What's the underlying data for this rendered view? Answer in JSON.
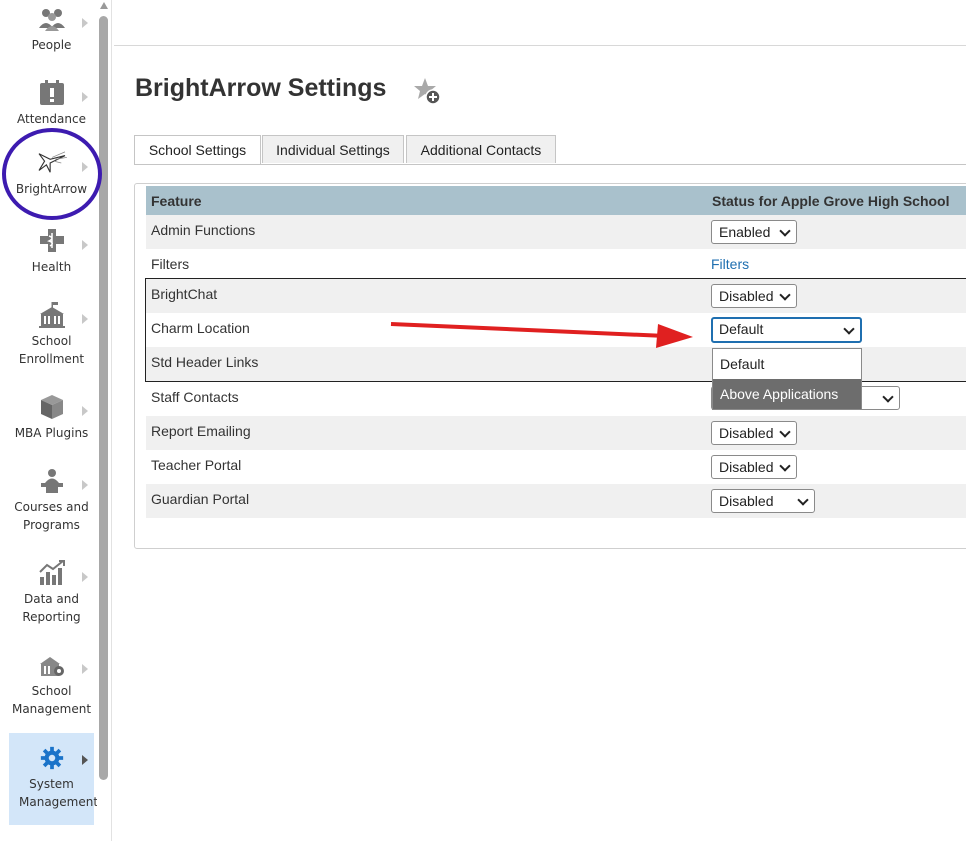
{
  "nav": {
    "items": [
      {
        "label": "People",
        "icon": "people-icon"
      },
      {
        "label": "Attendance",
        "icon": "attendance-icon"
      },
      {
        "label": "BrightArrow",
        "icon": "brightarrow-icon"
      },
      {
        "label": "Health",
        "icon": "health-icon"
      },
      {
        "label": "School Enrollment",
        "icon": "school-building-icon"
      },
      {
        "label": "MBA Plugins",
        "icon": "plugin-cube-icon"
      },
      {
        "label": "Courses and Programs",
        "icon": "courses-icon"
      },
      {
        "label": "Data and Reporting",
        "icon": "chart-icon"
      },
      {
        "label": "School Management",
        "icon": "school-management-icon"
      },
      {
        "label": "System Management",
        "icon": "gear-icon",
        "active": true
      }
    ]
  },
  "page": {
    "title": "BrightArrow Settings"
  },
  "tabs": [
    {
      "label": "School Settings",
      "active": true
    },
    {
      "label": "Individual Settings"
    },
    {
      "label": "Additional Contacts"
    }
  ],
  "table": {
    "headers": {
      "feature": "Feature",
      "status": "Status for Apple Grove High School"
    },
    "rows": [
      {
        "feature": "Admin Functions",
        "value": "Enabled"
      },
      {
        "feature": "Filters",
        "link": "Filters"
      },
      {
        "feature": "BrightChat",
        "value": "Disabled"
      },
      {
        "feature": "Charm Location",
        "value": "Default"
      },
      {
        "feature": "Std Header Links"
      },
      {
        "feature": "Staff Contacts"
      },
      {
        "feature": "Report Emailing",
        "value": "Disabled"
      },
      {
        "feature": "Teacher Portal",
        "value": "Disabled"
      },
      {
        "feature": "Guardian Portal",
        "value": "Disabled"
      }
    ]
  },
  "dropdown": {
    "options": [
      "Default",
      "Above Applications"
    ],
    "highlighted": "Above Applications"
  },
  "colors": {
    "header_bg": "#a9c1cc",
    "link": "#1f6fb0",
    "active_nav": "#d3e6f9",
    "annotation_circle": "#3d1bb0",
    "annotation_arrow": "#e02020"
  }
}
